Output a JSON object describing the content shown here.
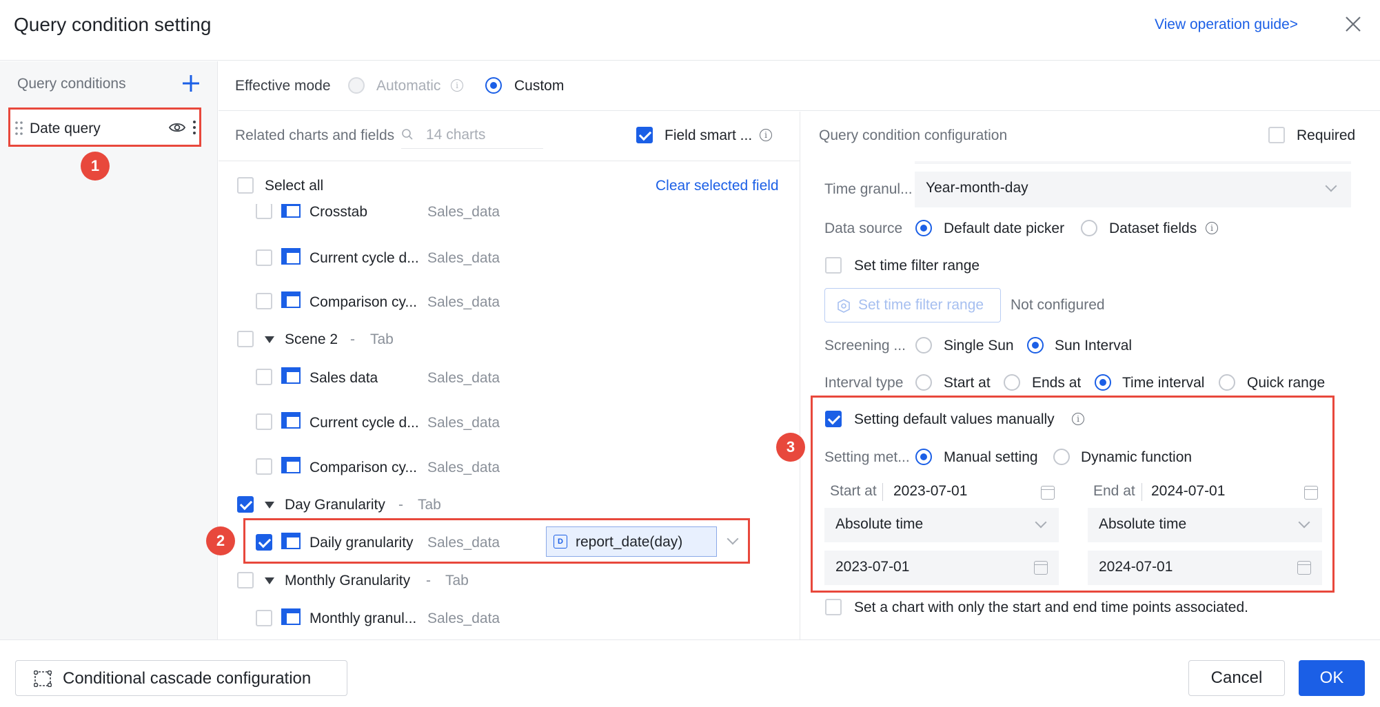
{
  "dialog": {
    "title": "Query condition setting",
    "guide_link": "View operation guide>"
  },
  "left": {
    "header": "Query conditions",
    "items": [
      {
        "label": "Date query"
      }
    ]
  },
  "badges": [
    "1",
    "2",
    "3"
  ],
  "effective_mode": {
    "label": "Effective mode",
    "options": [
      {
        "label": "Automatic",
        "selected": false,
        "disabled": true
      },
      {
        "label": "Custom",
        "selected": true
      }
    ]
  },
  "related": {
    "label": "Related charts and fields",
    "search_placeholder": "14 charts",
    "smart_label": "Field smart ...",
    "select_all": "Select all",
    "clear": "Clear selected field",
    "rows": [
      {
        "type": "chart",
        "name": "Crosstab",
        "dataset": "Sales_data",
        "checked": false
      },
      {
        "type": "chart",
        "name": "Current cycle d...",
        "dataset": "Sales_data",
        "checked": false
      },
      {
        "type": "chart",
        "name": "Comparison cy...",
        "dataset": "Sales_data",
        "checked": false
      },
      {
        "type": "group",
        "name": "Scene 2",
        "tag": "Tab",
        "checked": false
      },
      {
        "type": "chart",
        "name": "Sales data",
        "dataset": "Sales_data",
        "checked": false
      },
      {
        "type": "chart",
        "name": "Current cycle d...",
        "dataset": "Sales_data",
        "checked": false
      },
      {
        "type": "chart",
        "name": "Comparison cy...",
        "dataset": "Sales_data",
        "checked": false
      },
      {
        "type": "group",
        "name": "Day Granularity",
        "tag": "Tab",
        "checked": true
      },
      {
        "type": "chart",
        "name": "Daily granularity",
        "dataset": "Sales_data",
        "checked": true,
        "field": "report_date(day)"
      },
      {
        "type": "group",
        "name": "Monthly Granularity",
        "tag": "Tab",
        "checked": false
      },
      {
        "type": "chart",
        "name": "Monthly granul...",
        "dataset": "Sales_data",
        "checked": false
      }
    ],
    "tab_sep": "-"
  },
  "config": {
    "header": "Query condition configuration",
    "required": "Required",
    "time_granularity": {
      "label": "Time granul...",
      "value": "Year-month-day"
    },
    "data_source": {
      "label": "Data source",
      "options": [
        "Default date picker",
        "Dataset fields"
      ],
      "selected": 0
    },
    "set_range_check": "Set time filter range",
    "set_range_btn": "Set time filter range",
    "not_configured": "Not configured",
    "screening": {
      "label": "Screening ...",
      "options": [
        "Single Sun",
        "Sun Interval"
      ],
      "selected": 1
    },
    "interval_type": {
      "label": "Interval type",
      "options": [
        "Start at",
        "Ends at",
        "Time interval",
        "Quick range"
      ],
      "selected": 2
    },
    "default_manual": "Setting default values manually",
    "setting_method": {
      "label": "Setting met...",
      "options": [
        "Manual setting",
        "Dynamic function"
      ],
      "selected": 0
    },
    "start": {
      "label": "Start at",
      "date": "2023-07-01",
      "mode": "Absolute time",
      "value": "2023-07-01"
    },
    "end": {
      "label": "End at",
      "date": "2024-07-01",
      "mode": "Absolute time",
      "value": "2024-07-01"
    },
    "only_points": "Set a chart with only the start and end time points associated."
  },
  "footer": {
    "cascade": "Conditional cascade configuration",
    "cancel": "Cancel",
    "ok": "OK"
  },
  "colors": {
    "accent": "#1b5fe6",
    "highlight": "#e8483c"
  }
}
